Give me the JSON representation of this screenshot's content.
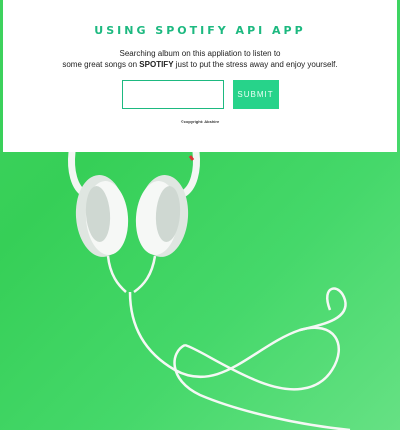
{
  "header": {
    "title": "USING SPOTIFY API APP",
    "desc_line1": "Searching album on this appliation to listen to",
    "desc_line2_pre": "some great songs on ",
    "desc_brand": "SPOTIFY",
    "desc_line2_post": " just to put the stress away and enjoy yourself."
  },
  "search": {
    "value": "",
    "placeholder": "",
    "submit_label": "SUBMIT"
  },
  "footer": {
    "copyright": "©copyright: Abshire"
  },
  "colors": {
    "accent": "#1db980",
    "button": "#27d38a",
    "background": "#3fd25e"
  },
  "background": {
    "subject": "white headphones on green background",
    "icon": "headphones-icon"
  }
}
